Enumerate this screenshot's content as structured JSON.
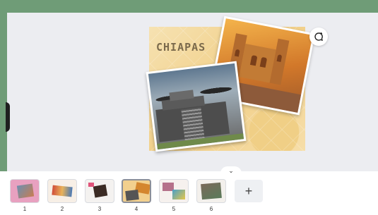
{
  "page": {
    "title": "CHIAPAS"
  },
  "controls": {
    "comment_icon": "comment-add-icon",
    "collapse_glyph": "⌄",
    "add_page_glyph": "+"
  },
  "pages": [
    {
      "number": "1"
    },
    {
      "number": "2"
    },
    {
      "number": "3"
    },
    {
      "number": "4",
      "selected": true
    },
    {
      "number": "5"
    },
    {
      "number": "6"
    }
  ],
  "colors": {
    "frame_green": "#6f9c77",
    "workspace": "#ecedf1"
  }
}
